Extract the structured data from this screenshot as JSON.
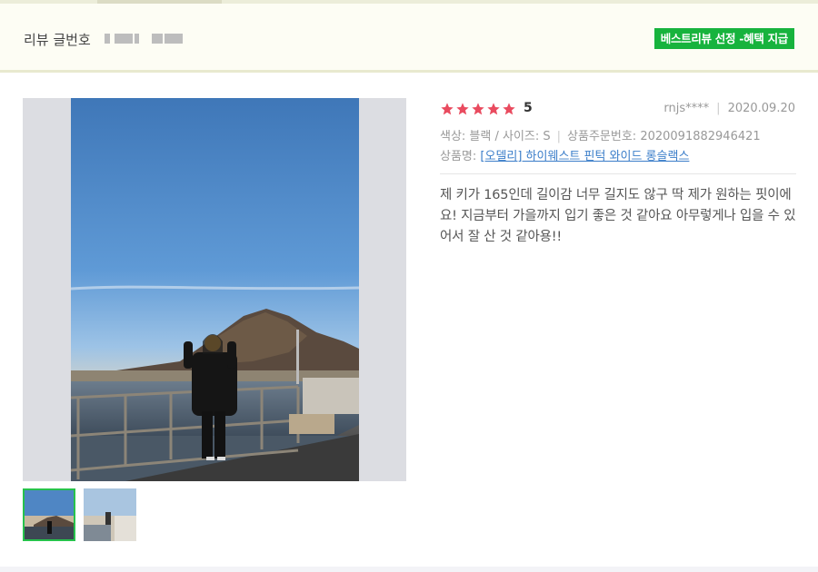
{
  "header": {
    "review_no_label": "리뷰 글번호",
    "best_badge": "베스트리뷰 선정 -혜택 지급"
  },
  "review": {
    "rating": "5",
    "stars_filled": 5,
    "star_color": "#e94b5f",
    "author": "rnjs****",
    "date": "2020.09.20",
    "option_label": "색상: 블랙 / 사이즈: S",
    "order_label": "상품주문번호:",
    "order_number": "2020091882946421",
    "product_label": "상품명:",
    "product_name": "[오델리] 하이웨스트 핀턱 와이드 롱슬랙스",
    "body": "제 키가 165인데 길이감 너무 길지도 않구 딱 제가 원하는 핏이에요! 지금부터 가을까지 입기 좋은 것 같아요 아무렇게나 입을 수 있어서 잘 산 것 같아용!!"
  },
  "colors": {
    "badge_bg": "#17b33d",
    "link": "#3a7dc9",
    "thumb_selected": "#27c24c"
  }
}
